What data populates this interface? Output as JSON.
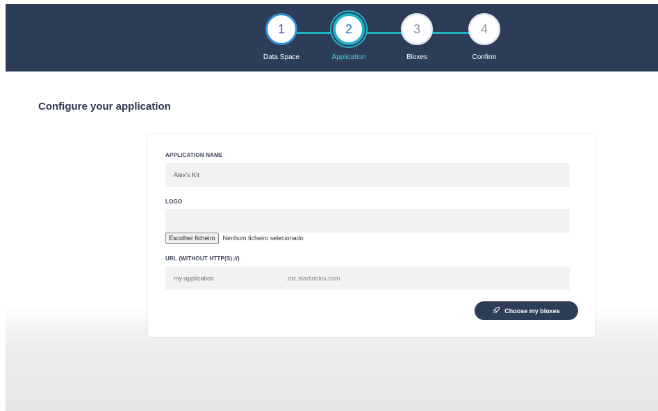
{
  "stepper": {
    "steps": [
      {
        "number": "1",
        "label": "Data Space",
        "state": "done"
      },
      {
        "number": "2",
        "label": "Application",
        "state": "active"
      },
      {
        "number": "3",
        "label": "Bloxes",
        "state": "inactive"
      },
      {
        "number": "4",
        "label": "Confirm",
        "state": "inactive"
      }
    ]
  },
  "page": {
    "title": "Configure your application"
  },
  "form": {
    "app_name_label": "APPLICATION NAME",
    "app_name_value": "Alex's Kit",
    "logo_label": "LOGO",
    "file_button_label": "Escolher ficheiro",
    "file_status": "Nenhum ficheiro selecionado",
    "url_label": "URL (WITHOUT HTTP(S)://)",
    "url_placeholder": "my-application",
    "url_suffix": ".otc.startinblox.com",
    "submit_label": "Choose my bloxes"
  },
  "colors": {
    "header_bg": "#2e3d57",
    "accent": "#1fb3c9",
    "step_ring": "#2b8fd8"
  }
}
